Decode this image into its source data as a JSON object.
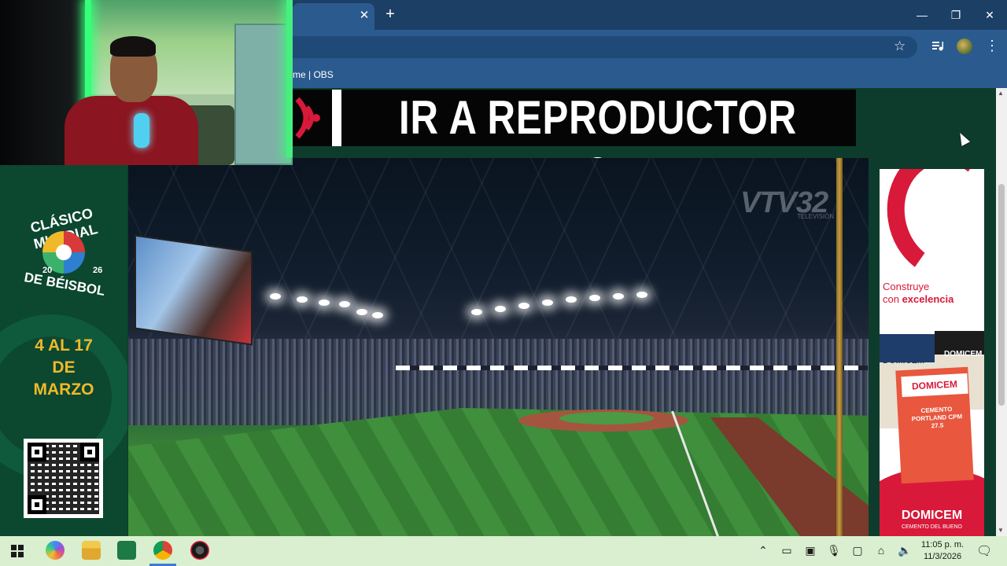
{
  "browser": {
    "tab_close": "✕",
    "new_tab": "+",
    "window_controls": {
      "minimize": "—",
      "restore": "❐",
      "close": "✕"
    },
    "star": "☆",
    "menu": "⋮",
    "bookmark_bar_text": "me | OBS"
  },
  "banner": {
    "text": "IR A REPRODUCTOR 2"
  },
  "video": {
    "watermark": "VTV32",
    "watermark_sub": "TELEVISIÓN"
  },
  "left_ad": {
    "logo_line1": "CLÁSICO MUNDIAL",
    "logo_year_left": "20",
    "logo_year_right": "26",
    "logo_line2": "DE BÉISBOL",
    "dates_line1": "4 AL 17",
    "dates_line2": "DE",
    "dates_line3": "MARZO"
  },
  "right_ad": {
    "headline_1": "Construye",
    "headline_2a": "con ",
    "headline_2b": "excelencia",
    "bag_brand_left": "DOMICEM",
    "bag_brand_right": "DOMICEM",
    "bag_center_brand": "DOMICEM",
    "bag_center_product": "CEMENTO PORTLAND CPM 27.5",
    "brand": "DOMICEM",
    "tagline": "CEMENTO DEL BUENO"
  },
  "taskbar": {
    "tray_icons": [
      "chevron-up-icon",
      "battery-icon",
      "storage-icon",
      "microphone-icon",
      "display-icon",
      "network-icon",
      "volume-icon"
    ],
    "time": "11:05 p. m.",
    "date": "11/3/2026",
    "notification": "🗨"
  },
  "colors": {
    "tab_strip": "#1c3f66",
    "toolbar": "#2b5a8e",
    "page_bg": "#0e3c2c",
    "brand_red": "#d8193a",
    "tournament_gold": "#f0b92a",
    "taskbar": "#d9efcf"
  }
}
